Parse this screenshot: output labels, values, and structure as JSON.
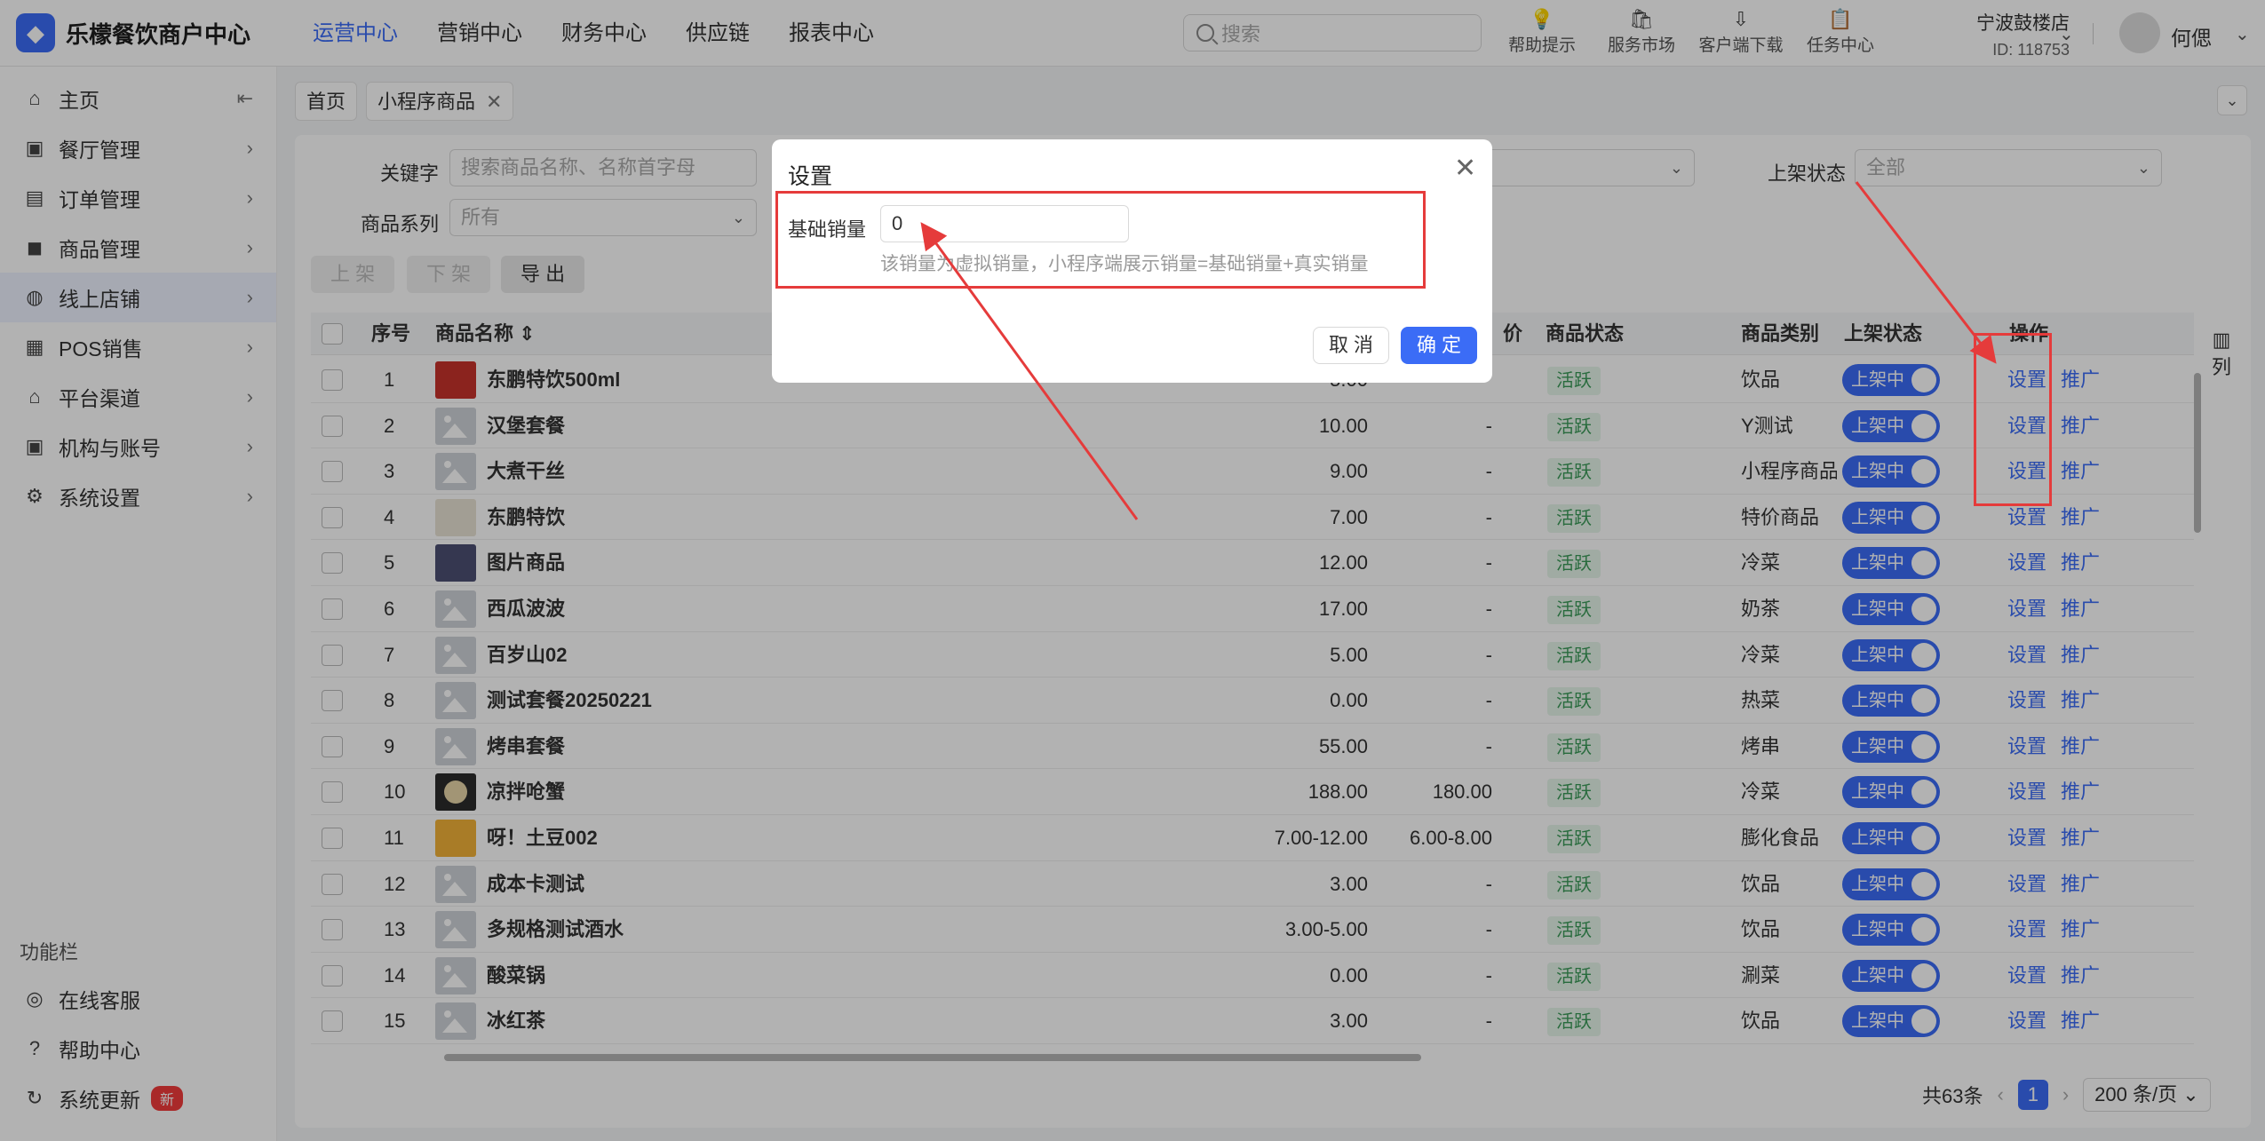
{
  "header": {
    "app_title": "乐檬餐饮商户中心",
    "nav": [
      "运营中心",
      "营销中心",
      "财务中心",
      "供应链",
      "报表中心"
    ],
    "search_placeholder": "搜索",
    "tools": [
      "帮助提示",
      "服务市场",
      "客户端下载",
      "任务中心"
    ],
    "store_name": "宁波鼓楼店",
    "store_id": "ID: 118753",
    "user_name": "何偲"
  },
  "sidebar": {
    "items": [
      "主页",
      "餐厅管理",
      "订单管理",
      "商品管理",
      "线上店铺",
      "POS销售",
      "平台渠道",
      "机构与账号",
      "系统设置"
    ],
    "section_title": "功能栏",
    "bottom_items": [
      "在线客服",
      "帮助中心",
      "系统更新"
    ],
    "new_badge": "新"
  },
  "tabs": [
    "首页",
    "小程序商品"
  ],
  "filters": {
    "keyword_label": "关键字",
    "keyword_placeholder": "搜索商品名称、名称首字母",
    "series_label": "商品系列",
    "series_value": "所有",
    "shelf_status_label": "上架状态",
    "shelf_status_value": "全部"
  },
  "actions": [
    "上 架",
    "下 架",
    "导 出"
  ],
  "table": {
    "headers": [
      "序号",
      "商品名称",
      "价",
      "商品状态",
      "商品类别",
      "上架状态",
      "操作"
    ],
    "column_settings": "列",
    "rows": [
      {
        "no": "1",
        "name": "东鹏特饮500ml",
        "price": "5.00",
        "member_price": "",
        "status": "活跃",
        "category": "饮品",
        "shelf": "上架中"
      },
      {
        "no": "2",
        "name": "汉堡套餐",
        "price": "10.00",
        "member_price": "-",
        "status": "活跃",
        "category": "Y测试",
        "shelf": "上架中"
      },
      {
        "no": "3",
        "name": "大煮干丝",
        "price": "9.00",
        "member_price": "-",
        "status": "活跃",
        "category": "小程序商品",
        "shelf": "上架中"
      },
      {
        "no": "4",
        "name": "东鹏特饮",
        "price": "7.00",
        "member_price": "-",
        "status": "活跃",
        "category": "特价商品",
        "shelf": "上架中"
      },
      {
        "no": "5",
        "name": "图片商品",
        "price": "12.00",
        "member_price": "-",
        "status": "活跃",
        "category": "冷菜",
        "shelf": "上架中"
      },
      {
        "no": "6",
        "name": "西瓜波波",
        "price": "17.00",
        "member_price": "-",
        "status": "活跃",
        "category": "奶茶",
        "shelf": "上架中"
      },
      {
        "no": "7",
        "name": "百岁山02",
        "price": "5.00",
        "member_price": "-",
        "status": "活跃",
        "category": "冷菜",
        "shelf": "上架中"
      },
      {
        "no": "8",
        "name": "测试套餐20250221",
        "price": "0.00",
        "member_price": "-",
        "status": "活跃",
        "category": "热菜",
        "shelf": "上架中"
      },
      {
        "no": "9",
        "name": "烤串套餐",
        "price": "55.00",
        "member_price": "-",
        "status": "活跃",
        "category": "烤串",
        "shelf": "上架中"
      },
      {
        "no": "10",
        "name": "凉拌呛蟹",
        "price": "188.00",
        "member_price": "180.00",
        "status": "活跃",
        "category": "冷菜",
        "shelf": "上架中"
      },
      {
        "no": "11",
        "name": "呀！土豆002",
        "price": "7.00-12.00",
        "member_price": "6.00-8.00",
        "status": "活跃",
        "category": "膨化食品",
        "shelf": "上架中"
      },
      {
        "no": "12",
        "name": "成本卡测试",
        "price": "3.00",
        "member_price": "-",
        "status": "活跃",
        "category": "饮品",
        "shelf": "上架中"
      },
      {
        "no": "13",
        "name": "多规格测试酒水",
        "price": "3.00-5.00",
        "member_price": "-",
        "status": "活跃",
        "category": "饮品",
        "shelf": "上架中"
      },
      {
        "no": "14",
        "name": "酸菜锅",
        "price": "0.00",
        "member_price": "-",
        "status": "活跃",
        "category": "涮菜",
        "shelf": "上架中"
      },
      {
        "no": "15",
        "name": "冰红茶",
        "price": "3.00",
        "member_price": "-",
        "status": "活跃",
        "category": "饮品",
        "shelf": "上架中"
      }
    ],
    "op_set": "设置",
    "op_promote": "推广"
  },
  "pagination": {
    "total": "共63条",
    "current": "1",
    "page_size": "200 条/页"
  },
  "dialog": {
    "title": "设置",
    "field_label": "基础销量",
    "field_value": "0",
    "hint": "该销量为虚拟销量，小程序端展示销量=基础销量+真实销量",
    "cancel": "取 消",
    "ok": "确 定"
  },
  "colors": {
    "accent": "#3b6cf6",
    "annotation": "#e53b3b",
    "active_tag": "#3a9a58"
  }
}
